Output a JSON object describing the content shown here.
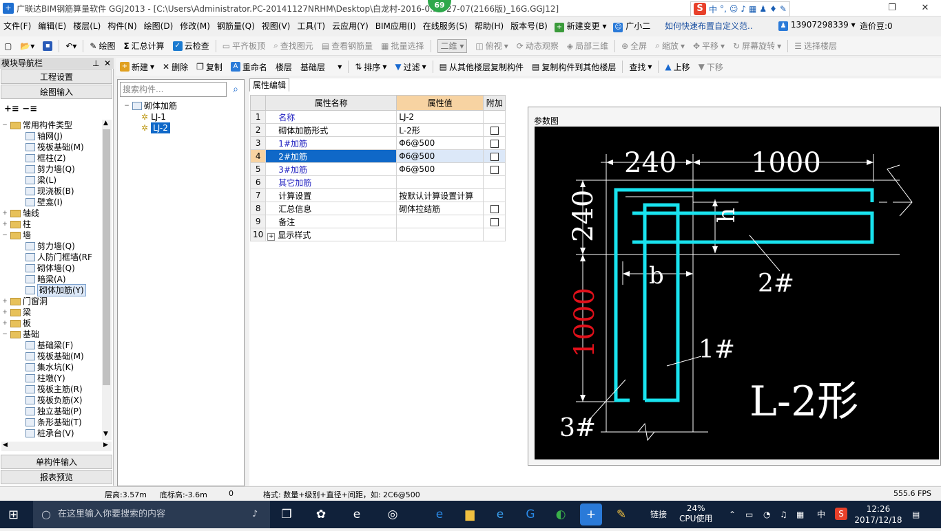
{
  "window": {
    "title": "广联达BIM钢筋算量软件 GGJ2013 - [C:\\Users\\Administrator.PC-20141127NRHM\\Desktop\\白龙村-2016-0…3-27-07(2166版)_16G.GGJ12]",
    "badge": "69",
    "ime": [
      "中",
      "°,"
    ]
  },
  "menu": {
    "items": [
      "文件(F)",
      "编辑(E)",
      "楼层(L)",
      "构件(N)",
      "绘图(D)",
      "修改(M)",
      "钢筋量(Q)",
      "视图(V)",
      "工具(T)",
      "云应用(Y)",
      "BIM应用(I)",
      "在线服务(S)",
      "帮助(H)",
      "版本号(B)",
      "新建变更",
      "广小二"
    ],
    "help_link": "如何快速布置自定义范..",
    "phone": "13907298339",
    "price_bean": "造价豆:0"
  },
  "toolbar1": {
    "items": [
      "绘图",
      "汇总计算",
      "云检查",
      "平齐板顶",
      "查找图元",
      "查看钢筋量",
      "批量选择"
    ],
    "view_mode": "二维",
    "view_items": [
      "俯视",
      "动态观察",
      "局部三维",
      "全屏",
      "缩放",
      "平移",
      "屏幕旋转",
      "选择楼层"
    ]
  },
  "toolbar2": {
    "items": [
      "新建",
      "删除",
      "复制",
      "重命名",
      "楼层",
      "基础层",
      "排序",
      "过滤",
      "从其他楼层复制构件",
      "复制构件到其他楼层",
      "查找",
      "上移",
      "下移"
    ]
  },
  "nav": {
    "header": "模块导航栏",
    "project_settings": "工程设置",
    "drawing_input": "绘图输入",
    "single_input": "单构件输入",
    "report_preview": "报表预览",
    "tree": [
      {
        "level": 0,
        "toggle": "−",
        "type": "folder",
        "label": "常用构件类型"
      },
      {
        "level": 1,
        "toggle": "",
        "type": "item",
        "label": "轴网(J)"
      },
      {
        "level": 1,
        "toggle": "",
        "type": "item",
        "label": "筏板基础(M)"
      },
      {
        "level": 1,
        "toggle": "",
        "type": "item",
        "label": "框柱(Z)"
      },
      {
        "level": 1,
        "toggle": "",
        "type": "item",
        "label": "剪力墙(Q)"
      },
      {
        "level": 1,
        "toggle": "",
        "type": "item",
        "label": "梁(L)"
      },
      {
        "level": 1,
        "toggle": "",
        "type": "item",
        "label": "现浇板(B)"
      },
      {
        "level": 1,
        "toggle": "",
        "type": "item",
        "label": "壁龛(I)"
      },
      {
        "level": 0,
        "toggle": "+",
        "type": "folder",
        "label": "轴线"
      },
      {
        "level": 0,
        "toggle": "+",
        "type": "folder",
        "label": "柱"
      },
      {
        "level": 0,
        "toggle": "−",
        "type": "folder",
        "label": "墙"
      },
      {
        "level": 1,
        "toggle": "",
        "type": "item",
        "label": "剪力墙(Q)"
      },
      {
        "level": 1,
        "toggle": "",
        "type": "item",
        "label": "人防门框墙(RF"
      },
      {
        "level": 1,
        "toggle": "",
        "type": "item",
        "label": "砌体墙(Q)"
      },
      {
        "level": 1,
        "toggle": "",
        "type": "item",
        "label": "暗梁(A)"
      },
      {
        "level": 1,
        "toggle": "",
        "type": "item",
        "label": "砌体加筋(Y)",
        "selected": true
      },
      {
        "level": 0,
        "toggle": "+",
        "type": "folder",
        "label": "门窗洞"
      },
      {
        "level": 0,
        "toggle": "+",
        "type": "folder",
        "label": "梁"
      },
      {
        "level": 0,
        "toggle": "+",
        "type": "folder",
        "label": "板"
      },
      {
        "level": 0,
        "toggle": "−",
        "type": "folder",
        "label": "基础"
      },
      {
        "level": 1,
        "toggle": "",
        "type": "item",
        "label": "基础梁(F)"
      },
      {
        "level": 1,
        "toggle": "",
        "type": "item",
        "label": "筏板基础(M)"
      },
      {
        "level": 1,
        "toggle": "",
        "type": "item",
        "label": "集水坑(K)"
      },
      {
        "level": 1,
        "toggle": "",
        "type": "item",
        "label": "柱墩(Y)"
      },
      {
        "level": 1,
        "toggle": "",
        "type": "item",
        "label": "筏板主筋(R)"
      },
      {
        "level": 1,
        "toggle": "",
        "type": "item",
        "label": "筏板负筋(X)"
      },
      {
        "level": 1,
        "toggle": "",
        "type": "item",
        "label": "独立基础(P)"
      },
      {
        "level": 1,
        "toggle": "",
        "type": "item",
        "label": "条形基础(T)"
      },
      {
        "level": 1,
        "toggle": "",
        "type": "item",
        "label": "桩承台(V)"
      }
    ]
  },
  "components": {
    "search_placeholder": "搜索构件...",
    "root": "砌体加筋",
    "children": [
      "LJ-1",
      "LJ-2"
    ],
    "selected": "LJ-2"
  },
  "props": {
    "tab": "属性编辑",
    "headers": [
      "属性名称",
      "属性值",
      "附加"
    ],
    "rows": [
      {
        "n": "1",
        "name": "名称",
        "value": "LJ-2",
        "blue": true,
        "check": false
      },
      {
        "n": "2",
        "name": "砌体加筋形式",
        "value": "L-2形",
        "blue": false,
        "check": true
      },
      {
        "n": "3",
        "name": "1#加筋",
        "value": "Φ6@500",
        "blue": true,
        "check": true
      },
      {
        "n": "4",
        "name": "2#加筋",
        "value": "Φ6@500",
        "blue": true,
        "check": true,
        "selected": true
      },
      {
        "n": "5",
        "name": "3#加筋",
        "value": "Φ6@500",
        "blue": true,
        "check": true
      },
      {
        "n": "6",
        "name": "其它加筋",
        "value": "",
        "blue": true,
        "check": false
      },
      {
        "n": "7",
        "name": "计算设置",
        "value": "按默认计算设置计算",
        "blue": false,
        "check": false
      },
      {
        "n": "8",
        "name": "汇总信息",
        "value": "砌体拉结筋",
        "blue": false,
        "check": true
      },
      {
        "n": "9",
        "name": "备注",
        "value": "",
        "blue": false,
        "check": true
      },
      {
        "n": "10",
        "name": "显示样式",
        "value": "",
        "blue": false,
        "check": false,
        "expand": "+"
      }
    ]
  },
  "diagram": {
    "header": "参数图",
    "dim_top_left": "240",
    "dim_top_right": "1000",
    "dim_left_top": "240",
    "dim_left_bottom": "1000",
    "label_h": "h",
    "label_b": "b",
    "label_1": "1#",
    "label_2": "2#",
    "label_3": "3#",
    "shape_label": "L-2形",
    "colors": {
      "bar": "#19e3ef",
      "dim": "#ffffff",
      "red": "#e0101a",
      "bg": "#000000"
    }
  },
  "status": {
    "floor_height": "层高:3.57m",
    "base_height": "底标高:-3.6m",
    "zero": "0",
    "format_hint": "格式: 数量+级别+直径+间距，如: 2C6@500",
    "fps": "555.6 FPS"
  },
  "taskbar": {
    "search_placeholder": "在这里输入你要搜索的内容",
    "link": "链接",
    "cpu_percent": "24%",
    "cpu_label": "CPU使用",
    "ime": "中",
    "time": "12:26",
    "date": "2017/12/18"
  }
}
